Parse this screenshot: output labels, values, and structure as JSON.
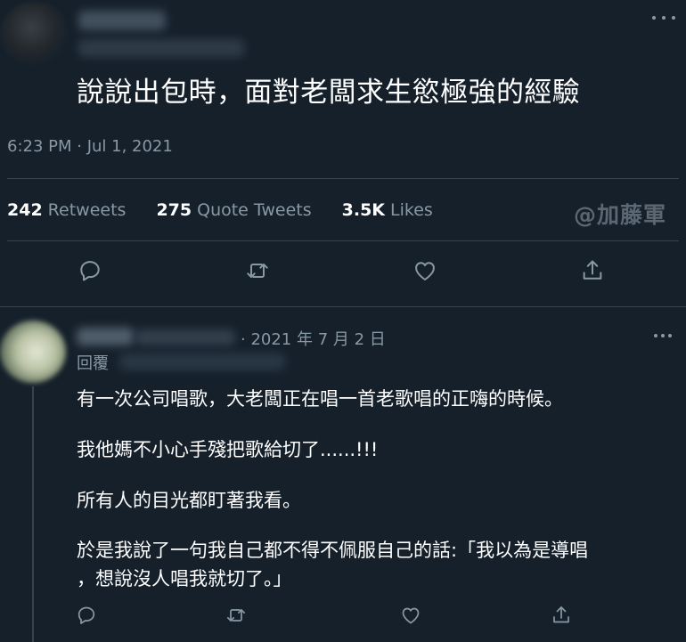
{
  "tweet": {
    "text": "說說出包時，面對老闆求生慾極強的經驗",
    "timestamp": "6:23 PM · Jul 1, 2021",
    "stats": {
      "retweets_count": "242",
      "retweets_label": "Retweets",
      "quotes_count": "275",
      "quotes_label": "Quote Tweets",
      "likes_count": "3.5K",
      "likes_label": "Likes"
    },
    "actions": [
      "reply-icon",
      "retweet-icon",
      "like-icon",
      "share-icon"
    ]
  },
  "watermark": "@加藤軍",
  "reply": {
    "date": "· 2021 年 7 月 2 日",
    "replying_to_label": "回覆",
    "lines": [
      "有一次公司唱歌，大老闆正在唱一首老歌唱的正嗨的時候。",
      "我他媽不小心手殘把歌給切了......!!!",
      "所有人的目光都盯著我看。",
      "於是我說了一句我自己都不得不佩服自己的話:「我以為是導唱",
      "，想說沒人唱我就切了。」"
    ],
    "actions": [
      "reply-icon",
      "retweet-icon",
      "like-icon",
      "share-icon"
    ]
  },
  "colors": {
    "background": "#15202b",
    "text_primary": "#ffffff",
    "text_secondary": "#8899a6",
    "divider": "#38444d"
  }
}
